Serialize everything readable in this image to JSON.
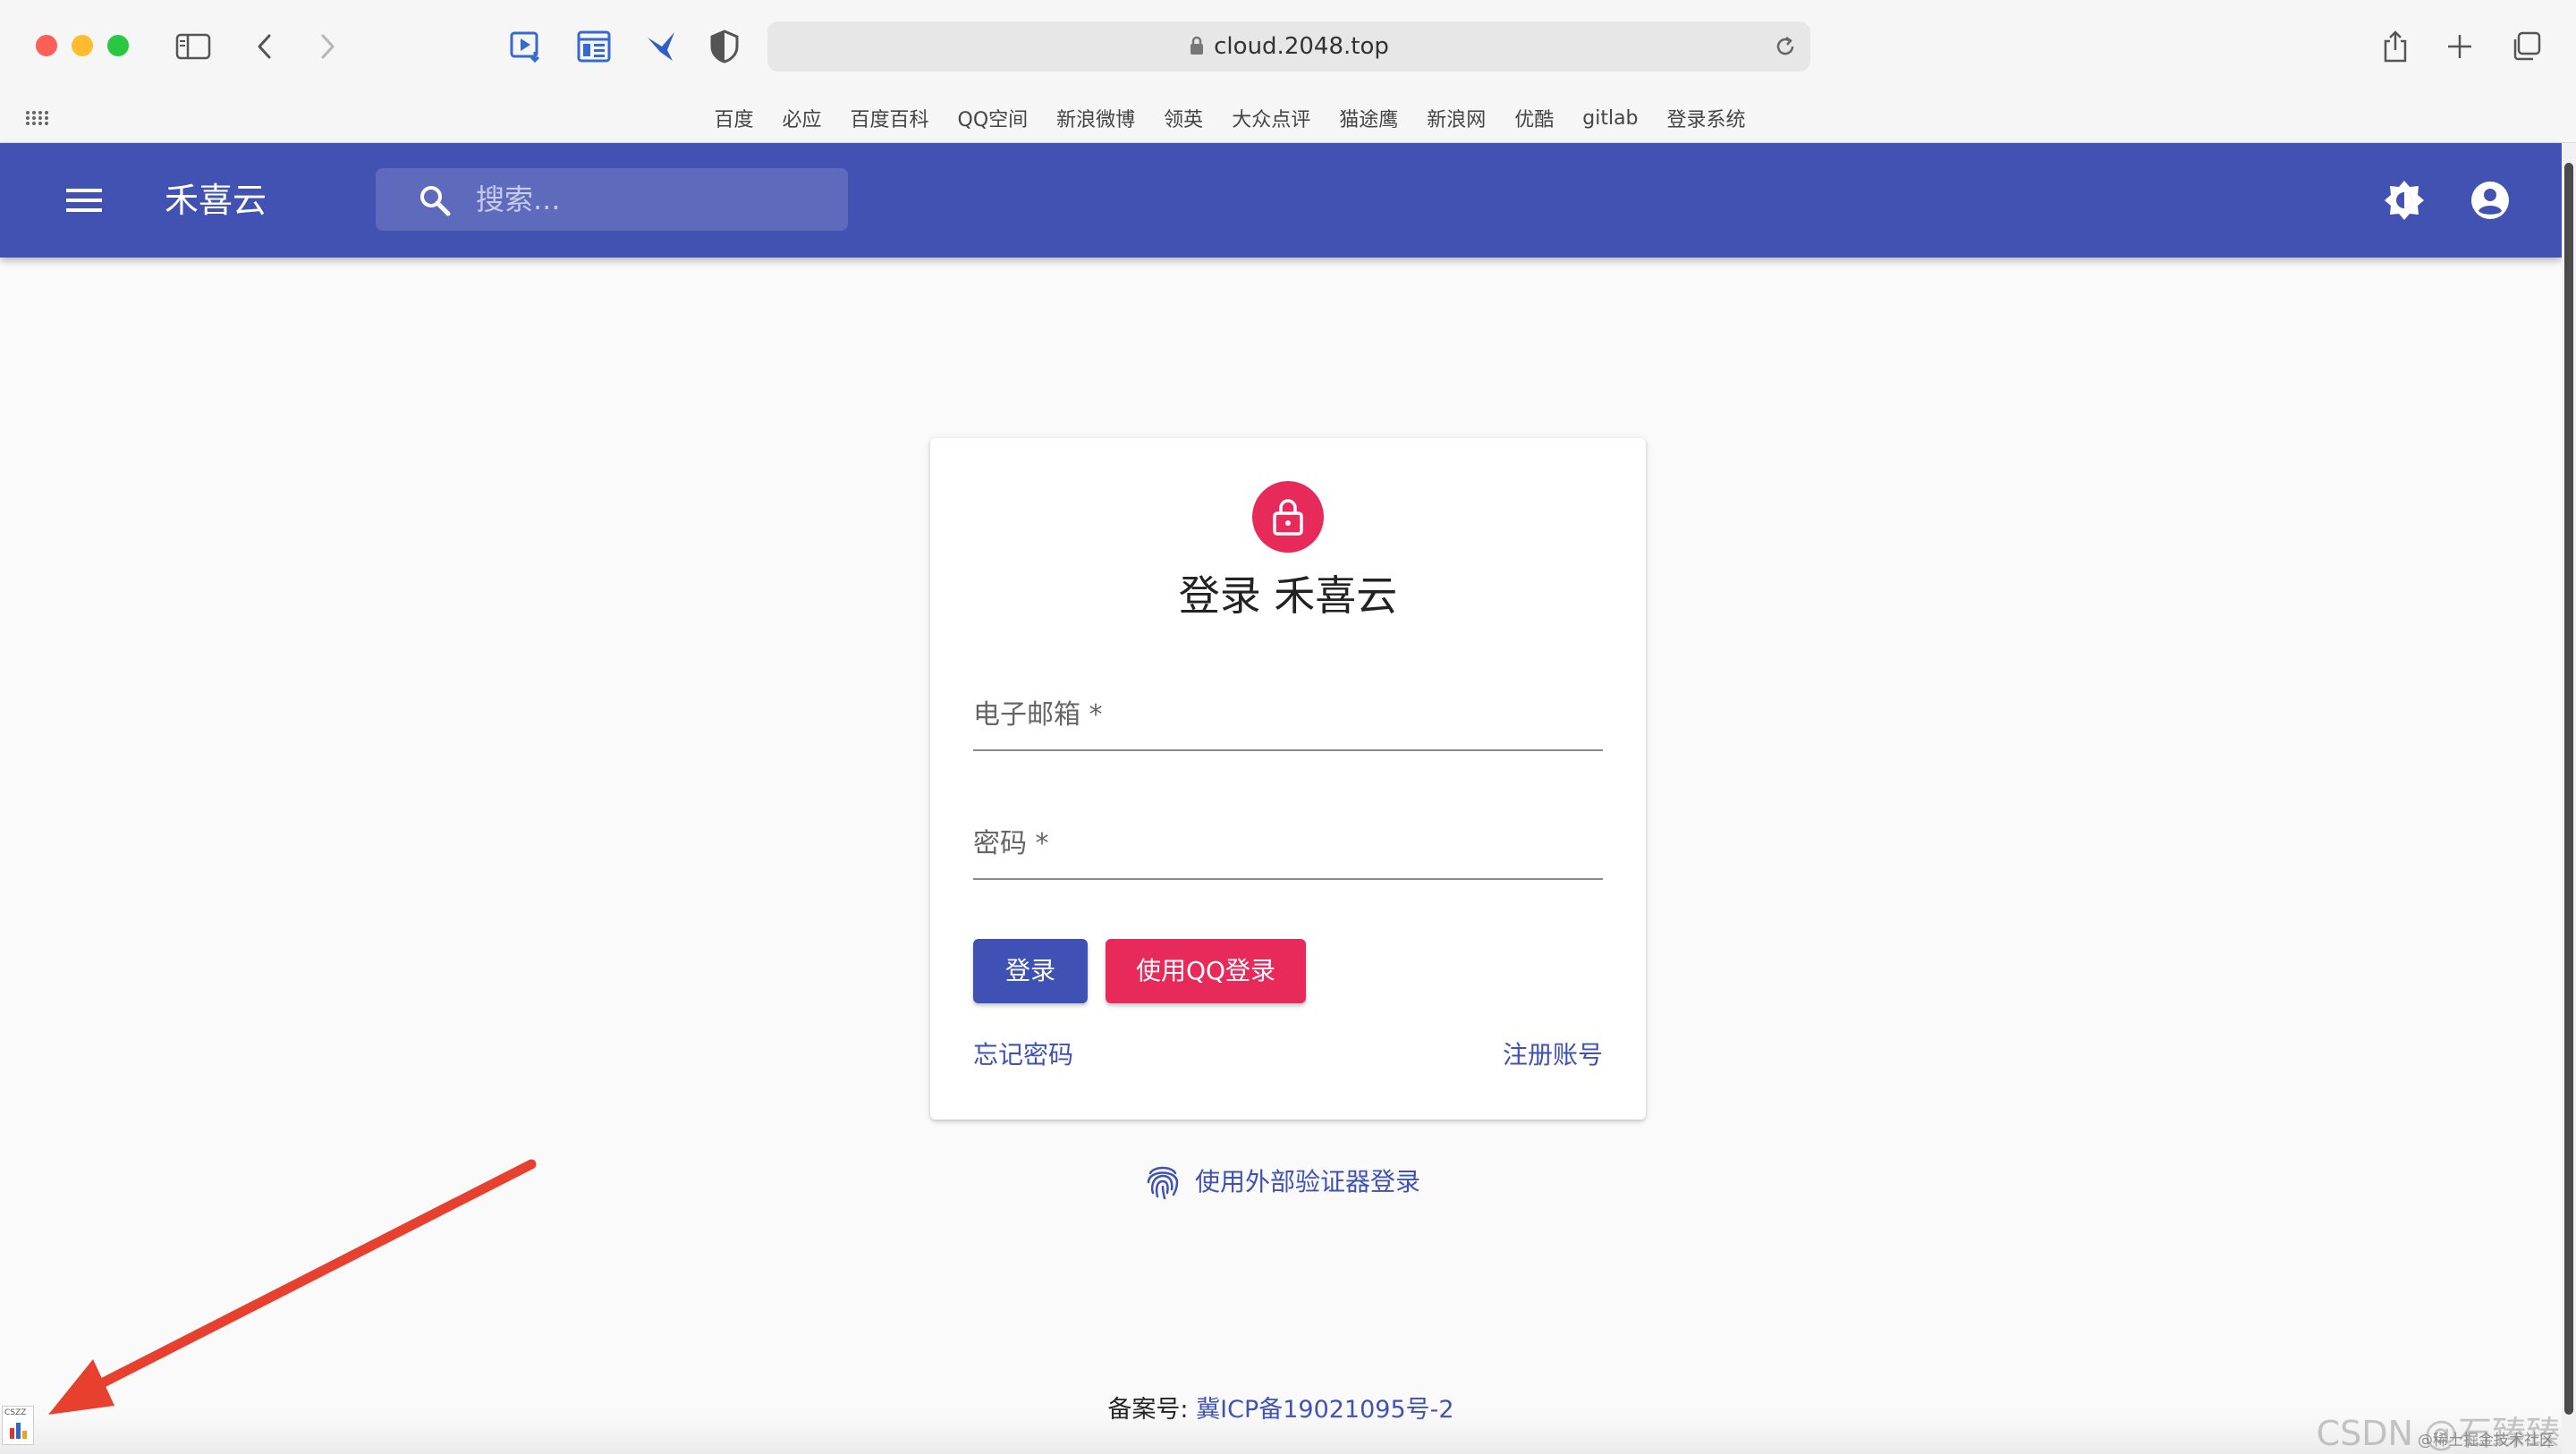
{
  "browser": {
    "url": "cloud.2048.top",
    "traffic_colors": {
      "close": "#fe5f57",
      "minimize": "#febc2e",
      "maximize": "#28c840"
    },
    "favorites": [
      "百度",
      "必应",
      "百度百科",
      "QQ空间",
      "新浪微博",
      "领英",
      "大众点评",
      "猫途鹰",
      "新浪网",
      "优酷",
      "gitlab",
      "登录系统"
    ]
  },
  "appbar": {
    "title": "禾喜云",
    "search_placeholder": "搜索...",
    "color": "#4252b2"
  },
  "login": {
    "title": "登录 禾喜云",
    "email_label": "电子邮箱 *",
    "password_label": "密码 *",
    "login_button": "登录",
    "qq_button": "使用QQ登录",
    "forgot_link": "忘记密码",
    "register_link": "注册账号",
    "external_login": "使用外部验证器登录",
    "accent": "#e82a5b",
    "primary": "#3f51b5"
  },
  "footer": {
    "prefix": "备案号:",
    "icp": "冀ICP备19021095号-2"
  },
  "watermark": {
    "main": "CSDN @石臻臻",
    "sub": "@稀土掘金技术社区"
  }
}
